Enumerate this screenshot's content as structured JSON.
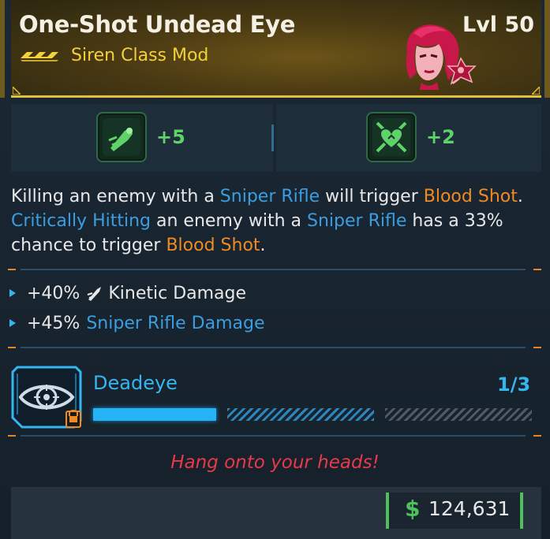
{
  "item": {
    "name": "One-Shot Undead Eye",
    "type": "Siren Class Mod",
    "level": "Lvl 50",
    "rarity_icon": "rarity-chevrons-icon",
    "portrait_icon": "siren-portrait-icon",
    "rarity_color": "#f3d13a"
  },
  "skill_bonuses": [
    {
      "icon": "sniper-shot-skill-icon",
      "value": "+5"
    },
    {
      "icon": "heart-crossed-swords-skill-icon",
      "value": "+2"
    }
  ],
  "description": {
    "parts": [
      {
        "text": "Killing an enemy with a ",
        "style": "normal"
      },
      {
        "text": "Sniper Rifle",
        "style": "blue"
      },
      {
        "text": " will trigger ",
        "style": "normal"
      },
      {
        "text": "Blood Shot",
        "style": "orange"
      },
      {
        "text": ". ",
        "style": "normal"
      },
      {
        "text": "Critically Hitting",
        "style": "blue"
      },
      {
        "text": " an enemy with a ",
        "style": "normal"
      },
      {
        "text": "Sniper Rifle",
        "style": "blue"
      },
      {
        "text": " has a 33% chance to trigger ",
        "style": "normal"
      },
      {
        "text": "Blood Shot",
        "style": "orange"
      },
      {
        "text": ".",
        "style": "normal"
      }
    ]
  },
  "stats": [
    {
      "value": "+40%",
      "icon": "kinetic-bullet-icon",
      "label": "Kinetic Damage",
      "color": "white"
    },
    {
      "value": "+45%",
      "label": "Sniper Rifle Damage",
      "color": "blue"
    }
  ],
  "perk": {
    "name": "Deadeye",
    "rank": "1/3",
    "rank_filled": 1,
    "rank_total": 3,
    "icon": "deadeye-eye-icon",
    "lock_icon": "lock-icon"
  },
  "flavor_text": "Hang onto your heads!",
  "price": {
    "symbol": "$",
    "amount": "124,631"
  },
  "colors": {
    "accent_gold": "#e3c03a",
    "accent_blue": "#35b6f0",
    "accent_orange": "#f08a22",
    "flavor_red": "#e8394a",
    "price_green": "#4ec25a"
  }
}
